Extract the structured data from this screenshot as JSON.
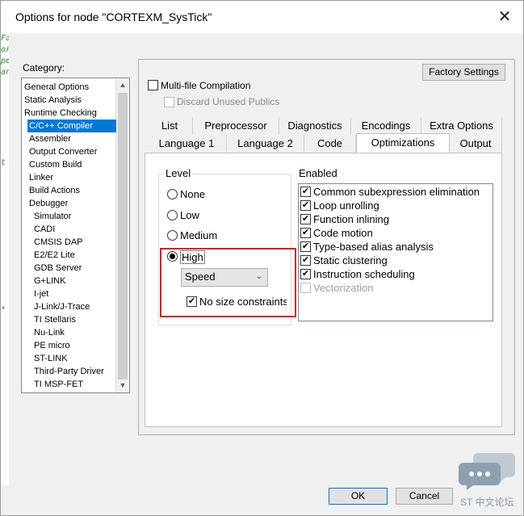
{
  "window": {
    "title": "Options for node \"CORTEXM_SysTick\"",
    "close_glyph": "✕"
  },
  "background_code": {
    "lines": [
      "Fa",
      "or",
      "pe",
      "an",
      "",
      "",
      "",
      "",
      "",
      "",
      "",
      "t",
      "",
      "",
      "",
      "",
      "",
      "",
      "",
      "",
      "",
      "",
      "",
      "",
      "*"
    ]
  },
  "category": {
    "label": "Category:",
    "items": [
      "General Options",
      "Static Analysis",
      "Runtime Checking",
      "C/C++ Compiler",
      "Assembler",
      "Output Converter",
      "Custom Build",
      "Linker",
      "Build Actions",
      "Debugger",
      "Simulator",
      "CADI",
      "CMSIS DAP",
      "E2/E2 Lite",
      "GDB Server",
      "G+LINK",
      "I-jet",
      "J-Link/J-Trace",
      "TI Stellaris",
      "Nu-Link",
      "PE micro",
      "ST-LINK",
      "Third-Party Driver",
      "TI MSP-FET"
    ],
    "selected": "C/C++ Compiler"
  },
  "panel": {
    "factory_settings": "Factory Settings",
    "multifile": {
      "label": "Multi-file Compilation",
      "checked": false
    },
    "discard": {
      "label": "Discard Unused Publics",
      "checked": false,
      "disabled": true
    }
  },
  "tabs": {
    "row1": [
      "List",
      "Preprocessor",
      "Diagnostics",
      "Encodings",
      "Extra Options"
    ],
    "row2": [
      "Language 1",
      "Language 2",
      "Code",
      "Optimizations",
      "Output"
    ],
    "active": "Optimizations"
  },
  "optimizations": {
    "level_title": "Level",
    "levels": [
      "None",
      "Low",
      "Medium",
      "High"
    ],
    "selected_level": "High",
    "goal_select": "Speed",
    "no_size_constraints": {
      "label": "No size constraints",
      "checked": true
    },
    "enabled_title": "Enabled",
    "enabled_items": [
      {
        "label": "Common subexpression elimination",
        "checked": true,
        "disabled": false
      },
      {
        "label": "Loop unrolling",
        "checked": true,
        "disabled": false
      },
      {
        "label": "Function inlining",
        "checked": true,
        "disabled": false
      },
      {
        "label": "Code motion",
        "checked": true,
        "disabled": false
      },
      {
        "label": "Type-based alias analysis",
        "checked": true,
        "disabled": false
      },
      {
        "label": "Static clustering",
        "checked": true,
        "disabled": false
      },
      {
        "label": "Instruction scheduling",
        "checked": true,
        "disabled": false
      },
      {
        "label": "Vectorization",
        "checked": false,
        "disabled": true
      }
    ]
  },
  "buttons": {
    "ok": "OK",
    "cancel": "Cancel"
  },
  "watermark": {
    "text": "ST 中文论坛"
  },
  "colors": {
    "selection": "#0078d7",
    "highlight_box": "#d21f1f"
  }
}
